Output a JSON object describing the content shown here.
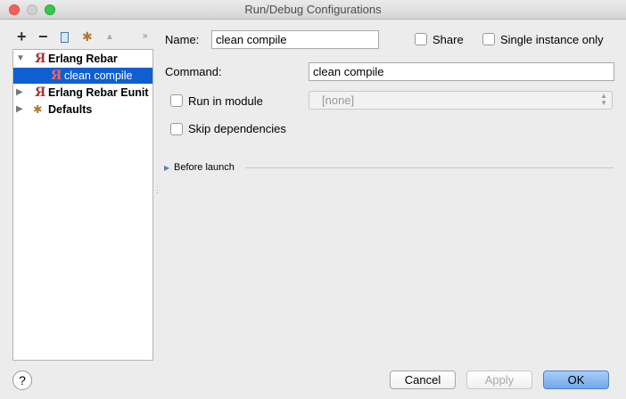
{
  "window": {
    "title": "Run/Debug Configurations"
  },
  "toolbar": {
    "add": "+",
    "remove": "−",
    "more": "»"
  },
  "tree": [
    {
      "label": "Erlang Rebar",
      "expanded": true
    },
    {
      "label": "clean compile",
      "selected": true
    },
    {
      "label": "Erlang Rebar Eunit",
      "expanded": false
    },
    {
      "label": "Defaults",
      "expanded": false
    }
  ],
  "form": {
    "name_label": "Name:",
    "name_value": "clean compile",
    "share_label": "Share",
    "single_instance_label": "Single instance only",
    "command_label": "Command:",
    "command_value": "clean compile",
    "run_in_module_label": "Run in module",
    "module_value": "[none]",
    "skip_deps_label": "Skip dependencies",
    "before_launch_label": "Before launch"
  },
  "buttons": {
    "help": "?",
    "cancel": "Cancel",
    "apply": "Apply",
    "ok": "OK"
  }
}
